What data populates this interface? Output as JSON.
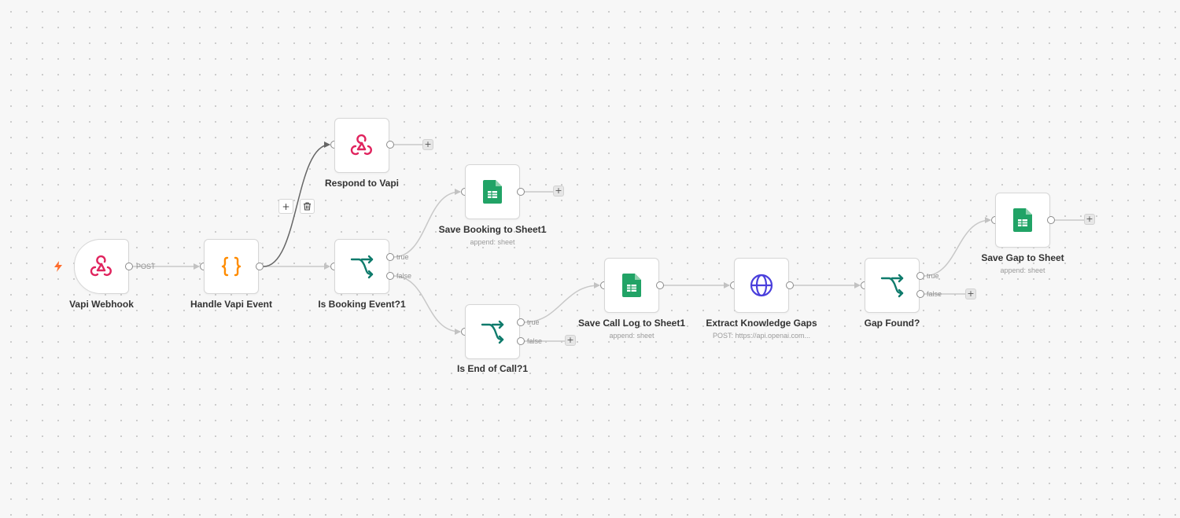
{
  "colors": {
    "webhook": "#e0245e",
    "code": "#ff8c00",
    "ifnode": "#0f7b6c",
    "sheets": "#21a366",
    "http": "#4a3fdc",
    "trigger_bolt": "#ff6d2d"
  },
  "nodes": {
    "vapi_webhook": {
      "name": "Vapi Webhook",
      "icon": "webhook-icon"
    },
    "handle_vapi_event": {
      "name": "Handle Vapi Event",
      "icon": "code-braces-icon"
    },
    "respond_to_vapi": {
      "name": "Respond to Vapi",
      "icon": "webhook-icon"
    },
    "is_booking_event": {
      "name": "Is Booking Event?1",
      "icon": "if-branch-icon"
    },
    "save_booking": {
      "name": "Save Booking to Sheet1",
      "subtitle": "append: sheet",
      "icon": "google-sheets-icon"
    },
    "is_end_of_call": {
      "name": "Is End of Call?1",
      "icon": "if-branch-icon"
    },
    "save_call_log": {
      "name": "Save Call Log to Sheet1",
      "subtitle": "append: sheet",
      "icon": "google-sheets-icon"
    },
    "extract_gaps": {
      "name": "Extract Knowledge Gaps",
      "subtitle": "POST: https://api.openai.com...",
      "icon": "globe-icon"
    },
    "gap_found": {
      "name": "Gap Found?",
      "icon": "if-branch-icon"
    },
    "save_gap": {
      "name": "Save Gap to Sheet",
      "subtitle": "append: sheet",
      "icon": "google-sheets-icon"
    }
  },
  "ports": {
    "post": "POST",
    "true": "true",
    "false": "false"
  },
  "edge_controls": {
    "add": "+",
    "delete_icon": "trash-icon"
  },
  "add_node": "+"
}
